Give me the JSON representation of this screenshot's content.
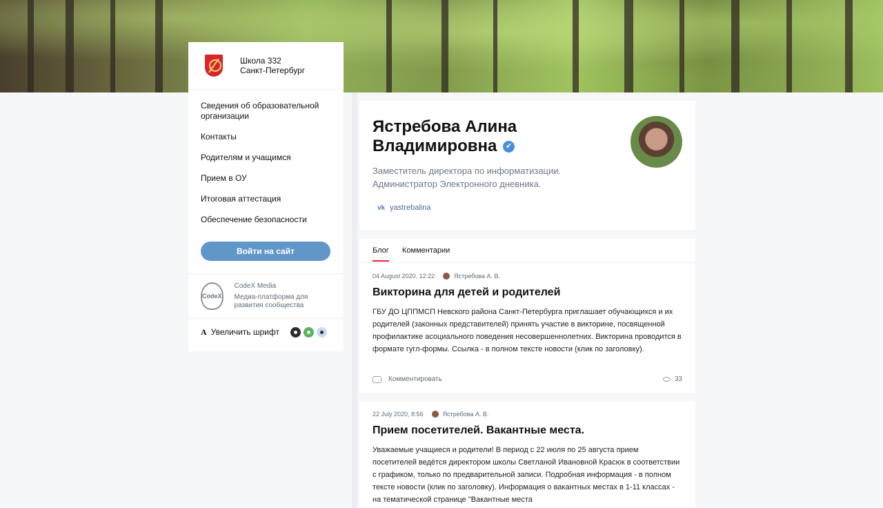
{
  "brand": {
    "line1": "Школа 332",
    "line2": "Санкт-Петербург"
  },
  "nav": [
    "Сведения об образовательной организации",
    "Контакты",
    "Родителям и учащимся",
    "Прием в ОУ",
    "Итоговая аттестация",
    "Обеспечение безопасности"
  ],
  "login_label": "Войти на сайт",
  "codex": {
    "title": "CodeX Media",
    "desc": "Медиа-платформа для развития сообщества",
    "logo_text": "CodeX"
  },
  "font_toggle": {
    "glyph": "A",
    "label": "Увеличить шрифт"
  },
  "theme_colors": [
    "#2b2b2b",
    "#5bb15c",
    "#c9dcf3"
  ],
  "profile": {
    "name_line1": "Ястребова Алина",
    "name_line2": "Владимировна",
    "verified_icon": "✔",
    "desc": "Заместитель директора по информатизации. Администратор Электронного дневника.",
    "vk_icon": "vk",
    "vk_handle": "yastrebalina"
  },
  "tabs": {
    "blog": "Блог",
    "comments": "Комментарии"
  },
  "posts": [
    {
      "date": "04 August 2020, 12:22",
      "author": "Ястребова А. В.",
      "title": "Викторина для детей и родителей",
      "text": "ГБУ ДО ЦППМСП Невского района Санкт-Петербурга приглашает обучающихся и их родителей (законных представителей) принять участие в викторине, посвященной профилактике асоциального поведения несовершеннолетних. Викторина проводится в формате гугл-формы. Ссылка  - в полном тексте новости (клик по заголовку).",
      "comment_label": "Комментировать",
      "views": "33"
    },
    {
      "date": "22 July 2020, 8:56",
      "author": "Ястребова А. В.",
      "title": "Прием посетителей. Вакантные места.",
      "text": "Уважаемые учащиеся и родители! В период с 22 июля по 25 августа прием посетителей ведётся директором школы Светланой Ивановной Красюк в соответствии с графиком, только по предварительной записи.  Подробная информация  - в полном тексте новости (клик по заголовку). Информация о вакантных местах в 1-11 классах - на тематической странице \"Вакантные места"
    }
  ]
}
